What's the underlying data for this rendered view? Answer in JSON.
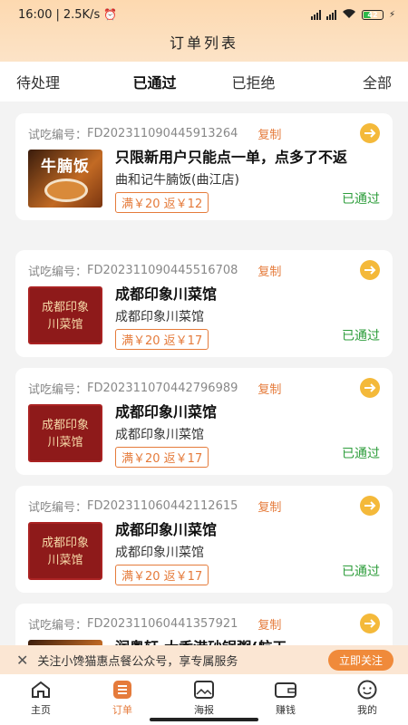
{
  "status_bar": {
    "time": "16:00",
    "speed": "2.5K/s",
    "battery": "42"
  },
  "header": {
    "title": "订单列表"
  },
  "tabs": [
    {
      "label": "待处理"
    },
    {
      "label": "已通过"
    },
    {
      "label": "已拒绝"
    },
    {
      "label": "全部"
    }
  ],
  "orders": [
    {
      "id_label": "试吃编号：",
      "id": "FD20231109044591​3264",
      "copy": "复制",
      "name": "只限新用户只能点一单，点多了不返",
      "shop": "曲和记牛腩饭(曲江店)",
      "promo": "满￥20 返￥12",
      "status": "已通过",
      "thumb_text": "牛腩饭"
    },
    {
      "id_label": "试吃编号：",
      "id": "FD20231109044551​6708",
      "copy": "复制",
      "name": "成都印象川菜馆",
      "shop": "成都印象川菜馆",
      "promo": "满￥20 返￥17",
      "status": "已通过",
      "thumb_text": "成都印象 川菜馆"
    },
    {
      "id_label": "试吃编号：",
      "id": "FD20231107044279​6989",
      "copy": "复制",
      "name": "成都印象川菜馆",
      "shop": "成都印象川菜馆",
      "promo": "满￥20 返￥17",
      "status": "已通过",
      "thumb_text": "成都印象 川菜馆"
    },
    {
      "id_label": "试吃编号：",
      "id": "FD20231106044211​2615",
      "copy": "复制",
      "name": "成都印象川菜馆",
      "shop": "成都印象川菜馆",
      "promo": "满￥20 返￥17",
      "status": "已通过",
      "thumb_text": "成都印象 川菜馆"
    },
    {
      "id_label": "试吃编号：",
      "id": "FD20231106044135​7921",
      "copy": "复制",
      "name": "润粤轩·大香港砂锅粥(航天",
      "shop": "",
      "promo": "",
      "status": "",
      "thumb_text": ""
    }
  ],
  "banner": {
    "text": "关注小馋猫惠点餐公众号，享专属服务",
    "button": "立即关注"
  },
  "nav": [
    {
      "label": "主页",
      "icon": "home-icon"
    },
    {
      "label": "订单",
      "icon": "order-list-icon"
    },
    {
      "label": "海报",
      "icon": "poster-icon"
    },
    {
      "label": "赚钱",
      "icon": "wallet-icon"
    },
    {
      "label": "我的",
      "icon": "profile-icon"
    }
  ],
  "colors": {
    "accent": "#e57b3b",
    "approved": "#2d9d3b",
    "header_bg": "#fdd9b0"
  }
}
